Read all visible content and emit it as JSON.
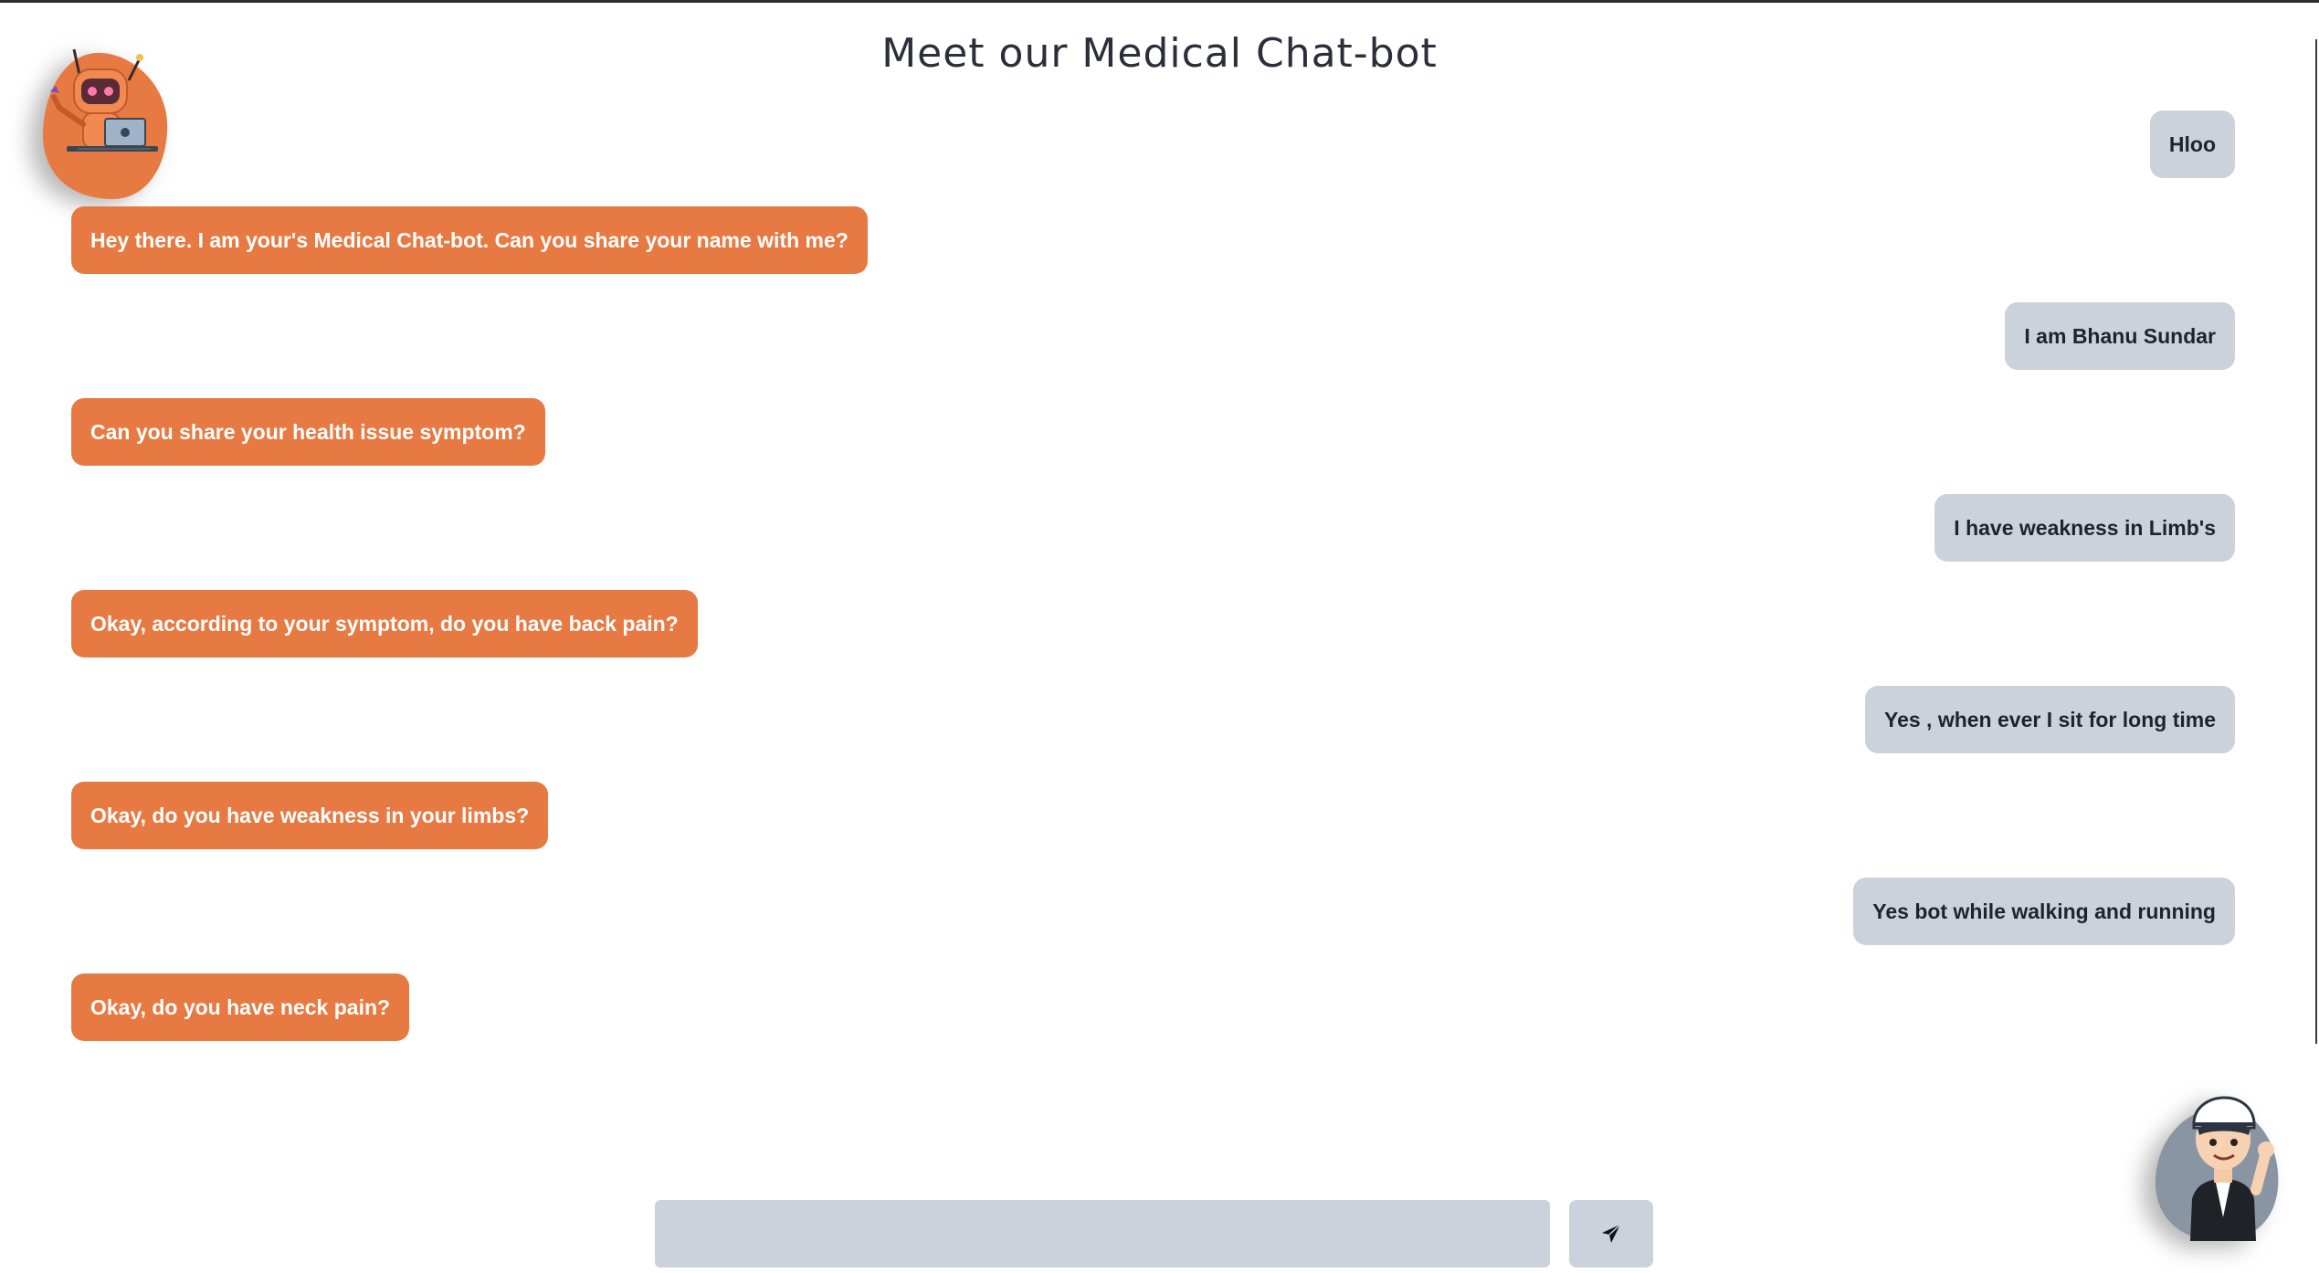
{
  "header": {
    "title": "Meet our Medical Chat-bot"
  },
  "chat": {
    "messages": [
      {
        "sender": "user",
        "text": "Hloo"
      },
      {
        "sender": "bot",
        "text": "Hey there. I am your's Medical Chat-bot. Can you share your name with me?"
      },
      {
        "sender": "user",
        "text": "I am Bhanu Sundar"
      },
      {
        "sender": "bot",
        "text": "Can you share your health issue symptom?"
      },
      {
        "sender": "user",
        "text": "I have weakness in Limb's"
      },
      {
        "sender": "bot",
        "text": "Okay, according to your symptom, do you have back pain?"
      },
      {
        "sender": "user",
        "text": "Yes , when ever I sit for long time"
      },
      {
        "sender": "bot",
        "text": "Okay, do you have weakness in your limbs?"
      },
      {
        "sender": "user",
        "text": "Yes bot while walking and running"
      },
      {
        "sender": "bot",
        "text": "Okay, do you have neck pain?"
      }
    ]
  },
  "composer": {
    "input_value": "",
    "placeholder": "",
    "send_icon": "paper-plane-icon"
  },
  "avatars": {
    "bot": "robot-avatar-icon",
    "user": "boy-avatar-icon"
  },
  "colors": {
    "bot_bubble": "#e77a43",
    "user_bubble": "#cbd2dc",
    "title": "#2b2f3a"
  }
}
